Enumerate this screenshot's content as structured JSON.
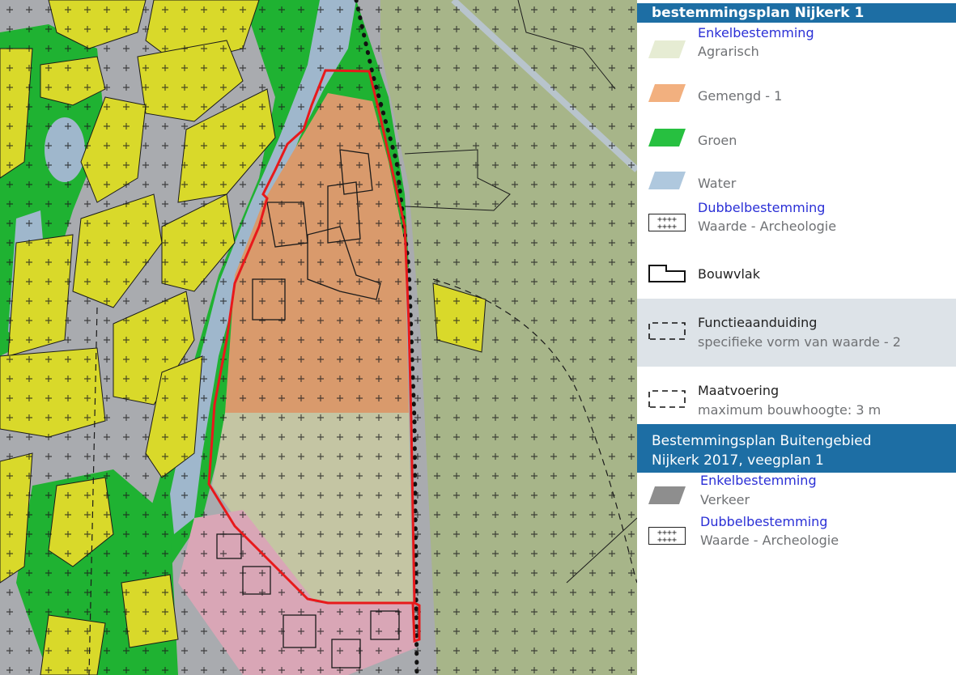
{
  "legend": {
    "section1": {
      "title": "bestemmingsplan Nijkerk 1",
      "enkelbestemming_heading": "Enkelbestemming",
      "items": [
        {
          "label": "Agrarisch",
          "color": "#e6ecd3"
        },
        {
          "label": "Gemengd - 1",
          "color": "#f2b07f"
        },
        {
          "label": "Groen",
          "color": "#27c040"
        },
        {
          "label": "Water",
          "color": "#afc8de"
        }
      ],
      "dubbelbestemming_heading": "Dubbelbestemming",
      "dubbelbestemming_label": "Waarde - Archeologie",
      "bouwvlak_label": "Bouwvlak",
      "functieaanduiding_heading": "Functieaanduiding",
      "functieaanduiding_label": "specifieke vorm van waarde - 2",
      "maatvoering_heading": "Maatvoering",
      "maatvoering_label": "maximum bouwhoogte: 3 m"
    },
    "section2": {
      "title_line1": "Bestemmingsplan Buitengebied",
      "title_line2": "Nijkerk 2017, veegplan 1",
      "enkelbestemming_heading": "Enkelbestemming",
      "verkeer_label": "Verkeer",
      "verkeer_color": "#8e8e8e",
      "dubbelbestemming_heading": "Dubbelbestemming",
      "dubbelbestemming_label": "Waarde - Archeologie"
    }
  },
  "colors": {
    "header_bg": "#1d6ea4",
    "road": "#a9abaf",
    "wonen": "#d9d92a",
    "groen": "#1fb232",
    "agrarisch_map": "#a7b589",
    "water": "#9fb7cc",
    "gemengd": "#d99a6c",
    "plangebied_outline": "#e8191b",
    "pink_area": "#d9a6b6"
  }
}
